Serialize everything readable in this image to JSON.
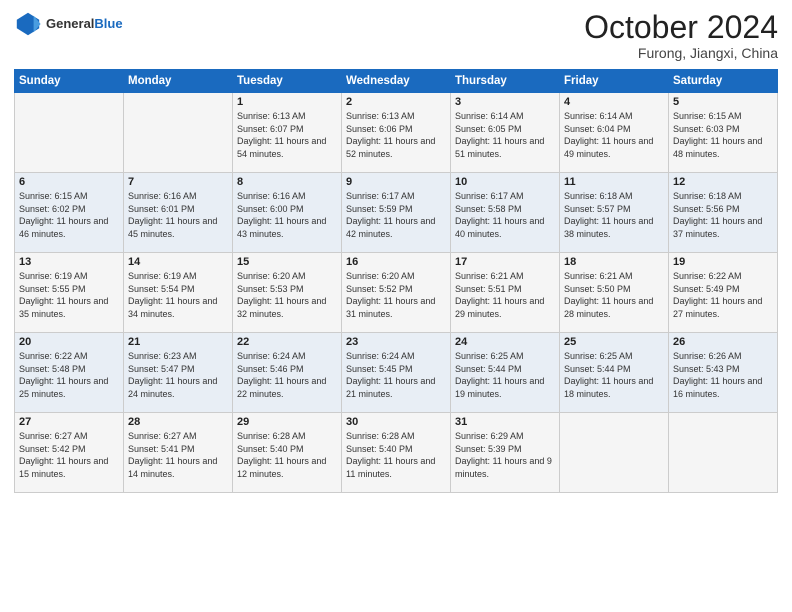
{
  "header": {
    "logo_general": "General",
    "logo_blue": "Blue",
    "month_title": "October 2024",
    "location": "Furong, Jiangxi, China"
  },
  "days_of_week": [
    "Sunday",
    "Monday",
    "Tuesday",
    "Wednesday",
    "Thursday",
    "Friday",
    "Saturday"
  ],
  "weeks": [
    [
      {
        "day": "",
        "info": ""
      },
      {
        "day": "",
        "info": ""
      },
      {
        "day": "1",
        "info": "Sunrise: 6:13 AM\nSunset: 6:07 PM\nDaylight: 11 hours and 54 minutes."
      },
      {
        "day": "2",
        "info": "Sunrise: 6:13 AM\nSunset: 6:06 PM\nDaylight: 11 hours and 52 minutes."
      },
      {
        "day": "3",
        "info": "Sunrise: 6:14 AM\nSunset: 6:05 PM\nDaylight: 11 hours and 51 minutes."
      },
      {
        "day": "4",
        "info": "Sunrise: 6:14 AM\nSunset: 6:04 PM\nDaylight: 11 hours and 49 minutes."
      },
      {
        "day": "5",
        "info": "Sunrise: 6:15 AM\nSunset: 6:03 PM\nDaylight: 11 hours and 48 minutes."
      }
    ],
    [
      {
        "day": "6",
        "info": "Sunrise: 6:15 AM\nSunset: 6:02 PM\nDaylight: 11 hours and 46 minutes."
      },
      {
        "day": "7",
        "info": "Sunrise: 6:16 AM\nSunset: 6:01 PM\nDaylight: 11 hours and 45 minutes."
      },
      {
        "day": "8",
        "info": "Sunrise: 6:16 AM\nSunset: 6:00 PM\nDaylight: 11 hours and 43 minutes."
      },
      {
        "day": "9",
        "info": "Sunrise: 6:17 AM\nSunset: 5:59 PM\nDaylight: 11 hours and 42 minutes."
      },
      {
        "day": "10",
        "info": "Sunrise: 6:17 AM\nSunset: 5:58 PM\nDaylight: 11 hours and 40 minutes."
      },
      {
        "day": "11",
        "info": "Sunrise: 6:18 AM\nSunset: 5:57 PM\nDaylight: 11 hours and 38 minutes."
      },
      {
        "day": "12",
        "info": "Sunrise: 6:18 AM\nSunset: 5:56 PM\nDaylight: 11 hours and 37 minutes."
      }
    ],
    [
      {
        "day": "13",
        "info": "Sunrise: 6:19 AM\nSunset: 5:55 PM\nDaylight: 11 hours and 35 minutes."
      },
      {
        "day": "14",
        "info": "Sunrise: 6:19 AM\nSunset: 5:54 PM\nDaylight: 11 hours and 34 minutes."
      },
      {
        "day": "15",
        "info": "Sunrise: 6:20 AM\nSunset: 5:53 PM\nDaylight: 11 hours and 32 minutes."
      },
      {
        "day": "16",
        "info": "Sunrise: 6:20 AM\nSunset: 5:52 PM\nDaylight: 11 hours and 31 minutes."
      },
      {
        "day": "17",
        "info": "Sunrise: 6:21 AM\nSunset: 5:51 PM\nDaylight: 11 hours and 29 minutes."
      },
      {
        "day": "18",
        "info": "Sunrise: 6:21 AM\nSunset: 5:50 PM\nDaylight: 11 hours and 28 minutes."
      },
      {
        "day": "19",
        "info": "Sunrise: 6:22 AM\nSunset: 5:49 PM\nDaylight: 11 hours and 27 minutes."
      }
    ],
    [
      {
        "day": "20",
        "info": "Sunrise: 6:22 AM\nSunset: 5:48 PM\nDaylight: 11 hours and 25 minutes."
      },
      {
        "day": "21",
        "info": "Sunrise: 6:23 AM\nSunset: 5:47 PM\nDaylight: 11 hours and 24 minutes."
      },
      {
        "day": "22",
        "info": "Sunrise: 6:24 AM\nSunset: 5:46 PM\nDaylight: 11 hours and 22 minutes."
      },
      {
        "day": "23",
        "info": "Sunrise: 6:24 AM\nSunset: 5:45 PM\nDaylight: 11 hours and 21 minutes."
      },
      {
        "day": "24",
        "info": "Sunrise: 6:25 AM\nSunset: 5:44 PM\nDaylight: 11 hours and 19 minutes."
      },
      {
        "day": "25",
        "info": "Sunrise: 6:25 AM\nSunset: 5:44 PM\nDaylight: 11 hours and 18 minutes."
      },
      {
        "day": "26",
        "info": "Sunrise: 6:26 AM\nSunset: 5:43 PM\nDaylight: 11 hours and 16 minutes."
      }
    ],
    [
      {
        "day": "27",
        "info": "Sunrise: 6:27 AM\nSunset: 5:42 PM\nDaylight: 11 hours and 15 minutes."
      },
      {
        "day": "28",
        "info": "Sunrise: 6:27 AM\nSunset: 5:41 PM\nDaylight: 11 hours and 14 minutes."
      },
      {
        "day": "29",
        "info": "Sunrise: 6:28 AM\nSunset: 5:40 PM\nDaylight: 11 hours and 12 minutes."
      },
      {
        "day": "30",
        "info": "Sunrise: 6:28 AM\nSunset: 5:40 PM\nDaylight: 11 hours and 11 minutes."
      },
      {
        "day": "31",
        "info": "Sunrise: 6:29 AM\nSunset: 5:39 PM\nDaylight: 11 hours and 9 minutes."
      },
      {
        "day": "",
        "info": ""
      },
      {
        "day": "",
        "info": ""
      }
    ]
  ]
}
